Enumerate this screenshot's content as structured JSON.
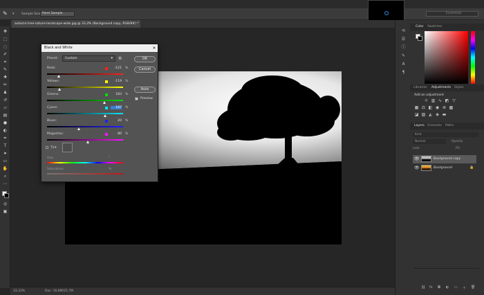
{
  "options_bar": {
    "sample_size_label": "Sample Size:",
    "sample_size_value": "Point Sample",
    "search_placeholder": "Essentials"
  },
  "document_tab": {
    "title": "autumn-tree-nature-landscape-wide.jpg @ 33,3% (Background copy, RGB/8#) *"
  },
  "status_bar": {
    "zoom": "33,33%",
    "doc_info": "Doc: 16,8M/25,7M"
  },
  "color_panel": {
    "tabs": [
      "Color",
      "Swatches"
    ],
    "active_tab": "Color"
  },
  "adjustments_panel": {
    "tabs": [
      "Libraries",
      "Adjustments",
      "Styles"
    ],
    "active_tab": "Adjustments",
    "heading": "Add an adjustment"
  },
  "layers_panel": {
    "tabs": [
      "Layers",
      "Channels",
      "Paths"
    ],
    "active_tab": "Layers",
    "kind_label": "Kind",
    "blend_mode": "Normal",
    "opacity_label": "Opacity",
    "lock_label": "Lock",
    "fill_label": "Fill",
    "layers": [
      {
        "name": "Background copy",
        "selected": true
      },
      {
        "name": "Background",
        "selected": false
      }
    ]
  },
  "bw_dialog": {
    "title": "Black and White",
    "preset_label": "Preset:",
    "preset_value": "Custom",
    "ok_label": "OK",
    "cancel_label": "Cancel",
    "auto_label": "Auto",
    "preview_label": "Preview",
    "preview_checked": true,
    "sliders": [
      {
        "label": "Reds:",
        "value": "-121",
        "swatch": "#ff2020",
        "fraction": 0.16,
        "gradient": "linear-gradient(to right,#000,#ff2020)"
      },
      {
        "label": "Yellows:",
        "value": "-119",
        "swatch": "#ffff00",
        "fraction": 0.17,
        "gradient": "linear-gradient(to right,#000,#ffff00)"
      },
      {
        "label": "Greens:",
        "value": "183",
        "swatch": "#00e000",
        "fraction": 0.76,
        "gradient": "linear-gradient(to right,#000,#00e000)"
      },
      {
        "label": "Cyans:",
        "value": "187",
        "swatch": "#00e5ff",
        "fraction": 0.77,
        "gradient": "linear-gradient(to right,#000,#00e5ff)",
        "highlight": true
      },
      {
        "label": "Blues:",
        "value": "20",
        "swatch": "#2020ff",
        "fraction": 0.42,
        "gradient": "linear-gradient(to right,#000,#2020ff)"
      },
      {
        "label": "Magentas:",
        "value": "80",
        "swatch": "#ff10ff",
        "fraction": 0.54,
        "gradient": "linear-gradient(to right,#000,#ff10ff)"
      }
    ],
    "tint_label": "Tint",
    "hue_label": "Hue",
    "hue_unit": "°",
    "saturation_label": "Saturation",
    "saturation_unit": "%",
    "percent_unit": "%"
  }
}
